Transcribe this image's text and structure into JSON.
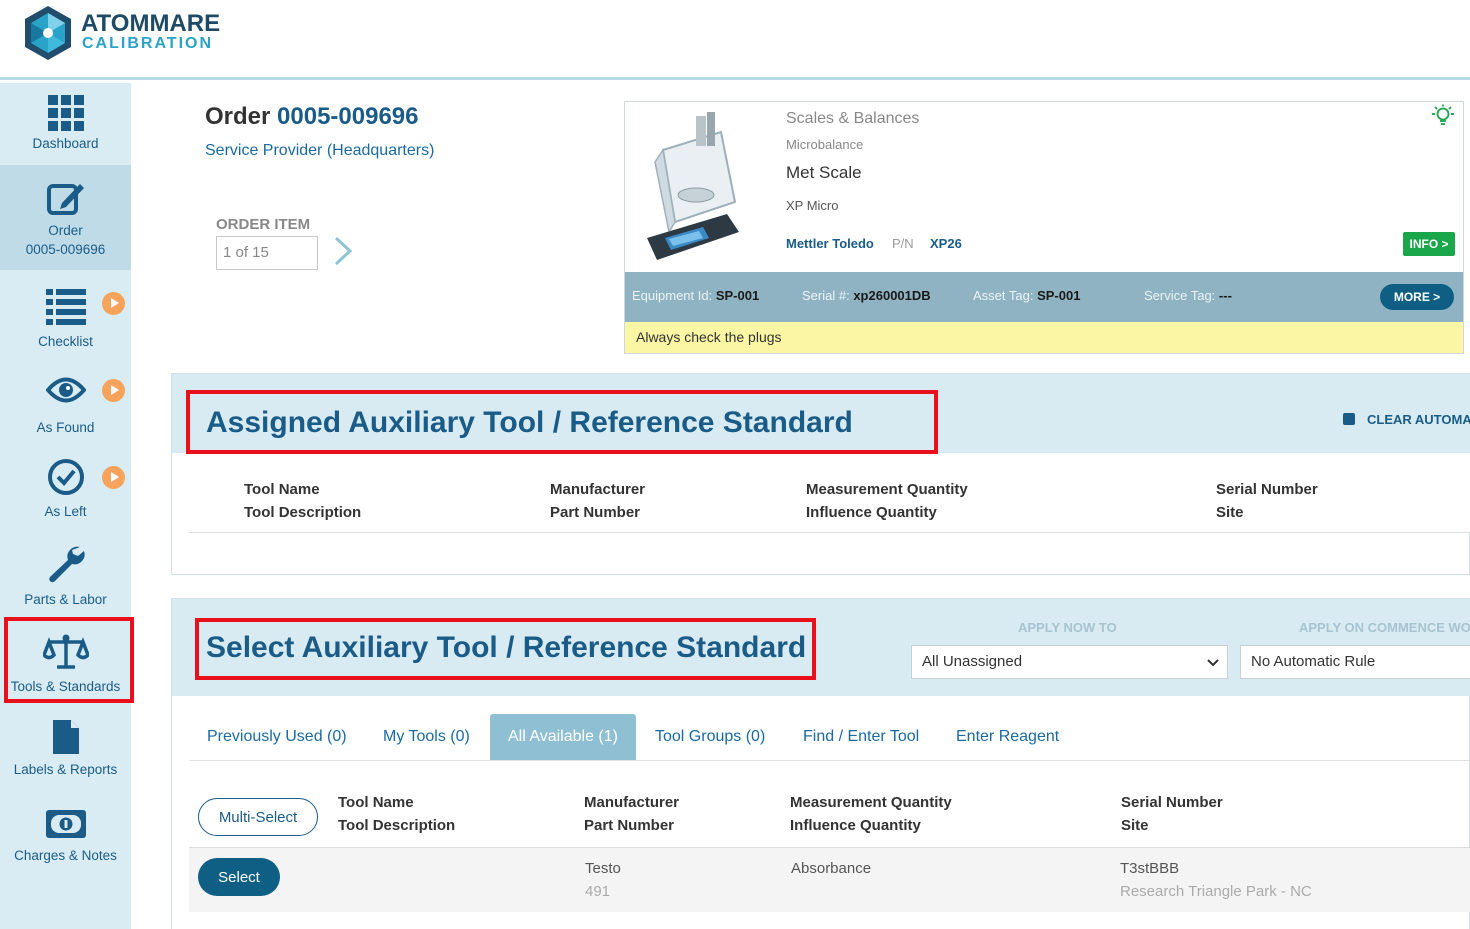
{
  "header": {
    "brand_line1": "ATOMMARE",
    "brand_line2": "CALIBRATION"
  },
  "sidebar": {
    "items": [
      {
        "label": "Dashboard"
      },
      {
        "label": "Order",
        "label2": "0005-009696"
      },
      {
        "label": "Checklist"
      },
      {
        "label": "As Found"
      },
      {
        "label": "As Left"
      },
      {
        "label": "Parts & Labor"
      },
      {
        "label": "Tools & Standards"
      },
      {
        "label": "Labels & Reports"
      },
      {
        "label": "Charges & Notes"
      }
    ]
  },
  "order": {
    "prefix": "Order",
    "number": "0005-009696",
    "provider": "Service Provider (Headquarters)",
    "item_label": "ORDER ITEM",
    "item_value": "1 of 15"
  },
  "equipment": {
    "category": "Scales & Balances",
    "subcategory": "Microbalance",
    "name": "Met Scale",
    "model": "XP Micro",
    "manufacturer": "Mettler Toledo",
    "pn_label": "P/N",
    "pn": "XP26",
    "info_label": "INFO >",
    "equipment_id_label": "Equipment Id:",
    "equipment_id": "SP-001",
    "serial_label": "Serial #:",
    "serial": "xp260001DB",
    "asset_label": "Asset Tag:",
    "asset": "SP-001",
    "service_label": "Service Tag:",
    "service": "---",
    "more_label": "MORE >",
    "note": "Always check the plugs"
  },
  "assigned": {
    "title": "Assigned Auxiliary Tool / Reference Standard",
    "clear_label": "CLEAR AUTOMA",
    "columns": [
      {
        "line1": "Tool Name",
        "line2": "Tool Description"
      },
      {
        "line1": "Manufacturer",
        "line2": "Part Number"
      },
      {
        "line1": "Measurement Quantity",
        "line2": "Influence Quantity"
      },
      {
        "line1": "Serial Number",
        "line2": "Site"
      }
    ]
  },
  "select": {
    "title": "Select Auxiliary Tool / Reference Standard",
    "apply_now_label": "APPLY NOW TO",
    "apply_now_value": "All Unassigned",
    "apply_commence_label": "APPLY ON COMMENCE WO",
    "apply_commence_value": "No Automatic Rule",
    "tabs": [
      {
        "label": "Previously Used (0)"
      },
      {
        "label": "My Tools (0)"
      },
      {
        "label": "All Available (1)"
      },
      {
        "label": "Tool Groups (0)"
      },
      {
        "label": "Find / Enter Tool"
      },
      {
        "label": "Enter Reagent"
      }
    ],
    "multi_select_label": "Multi-Select",
    "columns": [
      {
        "line1": "Tool Name",
        "line2": "Tool Description"
      },
      {
        "line1": "Manufacturer",
        "line2": "Part Number"
      },
      {
        "line1": "Measurement Quantity",
        "line2": "Influence Quantity"
      },
      {
        "line1": "Serial Number",
        "line2": "Site"
      }
    ],
    "rows": [
      {
        "select_label": "Select",
        "manufacturer": "Testo",
        "part_number": "491",
        "measurement": "Absorbance",
        "serial": "T3stBBB",
        "site": "Research Triangle Park - NC"
      }
    ]
  }
}
